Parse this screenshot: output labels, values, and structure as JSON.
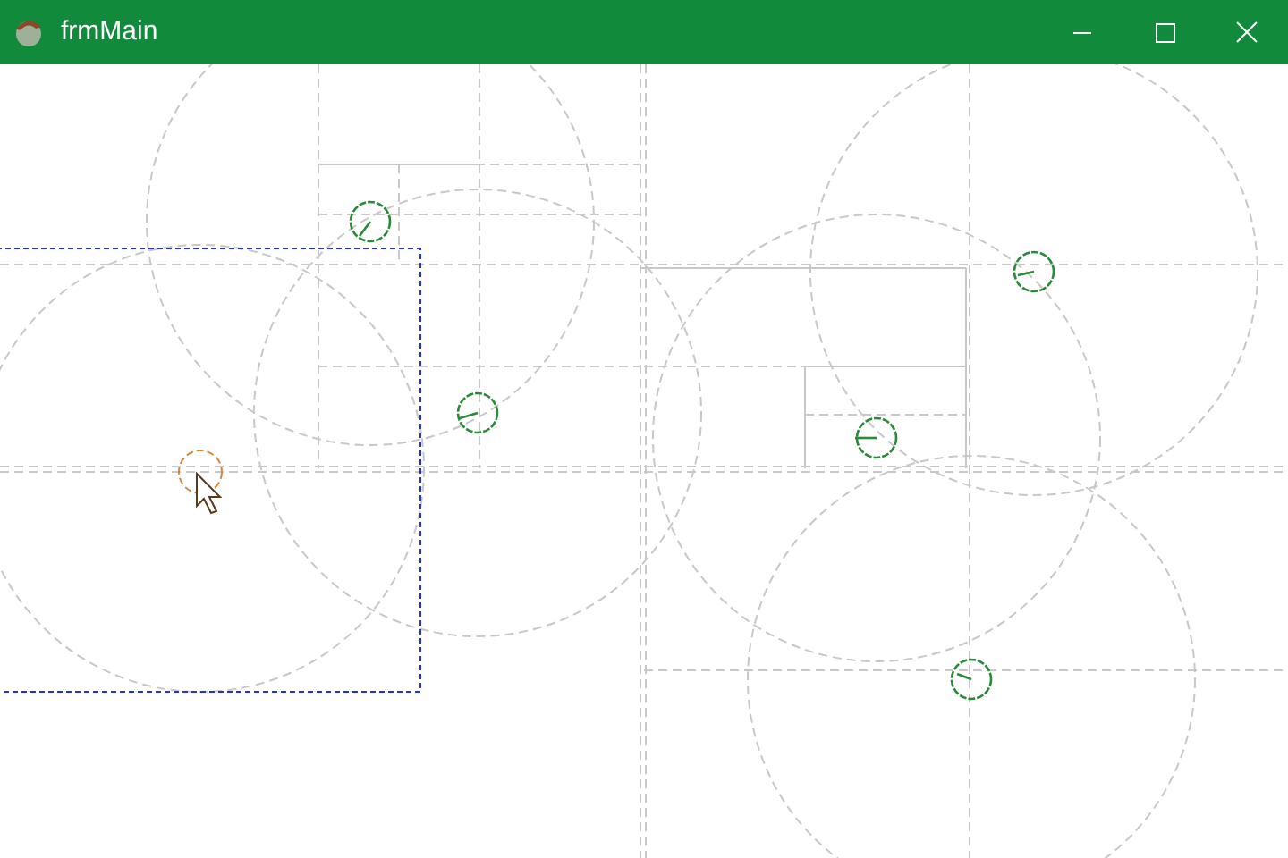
{
  "window": {
    "title": "frmMain"
  }
}
